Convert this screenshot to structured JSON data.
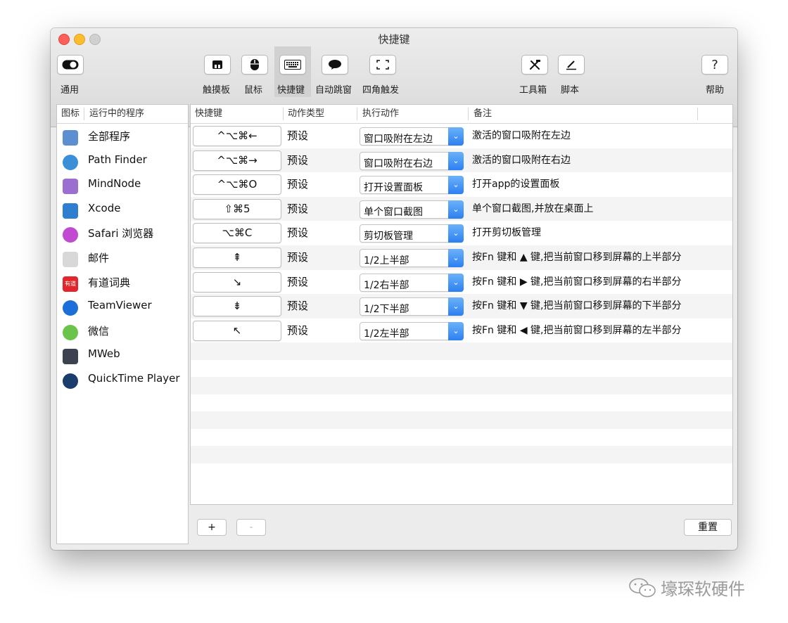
{
  "window": {
    "title": "快捷键"
  },
  "toolbar": {
    "general": "通用",
    "trackpad": "触摸板",
    "mouse": "鼠标",
    "shortcuts": "快捷键",
    "auto_snap": "自动跳窗",
    "hot_corners": "四角触发",
    "toolbox": "工具箱",
    "script": "脚本",
    "help": "帮助",
    "help_glyph": "?"
  },
  "apps_table": {
    "col_icon": "图标",
    "col_program": "运行中的程序",
    "items": [
      {
        "name": "全部程序",
        "icon": "all-programs-icon",
        "color": "#5b8fd0"
      },
      {
        "name": "Path Finder",
        "icon": "path-finder-icon",
        "color": "#3a8fd8"
      },
      {
        "name": "MindNode",
        "icon": "mindnode-icon",
        "color": "#9b6fd0"
      },
      {
        "name": "Xcode",
        "icon": "xcode-icon",
        "color": "#2f7fd0"
      },
      {
        "name": "Safari 浏览器",
        "icon": "safari-icon",
        "color": "#c04ad0"
      },
      {
        "name": "邮件",
        "icon": "mail-icon",
        "color": "#d8d8d8"
      },
      {
        "name": "有道词典",
        "icon": "youdao-icon",
        "color": "#e3262b"
      },
      {
        "name": "TeamViewer",
        "icon": "teamviewer-icon",
        "color": "#1c6fd8"
      },
      {
        "name": "微信",
        "icon": "wechat-icon",
        "color": "#6bc44a"
      },
      {
        "name": "MWeb",
        "icon": "mweb-icon",
        "color": "#3d4250"
      },
      {
        "name": "QuickTime Player",
        "icon": "quicktime-icon",
        "color": "#1a3d6e"
      }
    ],
    "youdao_glyph": "有道"
  },
  "shortcuts_table": {
    "col_key": "快捷键",
    "col_type": "动作类型",
    "col_action": "执行动作",
    "col_note": "备注",
    "rows": [
      {
        "key": "^⌥⌘←",
        "type": "预设",
        "action": "窗口吸附在左边",
        "note": "激活的窗口吸附在左边"
      },
      {
        "key": "^⌥⌘→",
        "type": "预设",
        "action": "窗口吸附在右边",
        "note": "激活的窗口吸附在右边"
      },
      {
        "key": "^⌥⌘O",
        "type": "预设",
        "action": "打开设置面板",
        "note": "打开app的设置面板"
      },
      {
        "key": "⇧⌘5",
        "type": "预设",
        "action": "单个窗口截图",
        "note": "单个窗口截图,并放在桌面上"
      },
      {
        "key": "⌥⌘C",
        "type": "预设",
        "action": "剪切板管理",
        "note": "打开剪切板管理"
      },
      {
        "key": "⇞",
        "type": "预设",
        "action": "1/2上半部",
        "note": "按Fn 键和 ▲ 键,把当前窗口移到屏幕的上半部分"
      },
      {
        "key": "↘",
        "type": "预设",
        "action": "1/2右半部",
        "note": "按Fn 键和 ▶ 键,把当前窗口移到屏幕的右半部分"
      },
      {
        "key": "⇟",
        "type": "预设",
        "action": "1/2下半部",
        "note": "按Fn 键和 ▼ 键,把当前窗口移到屏幕的下半部分"
      },
      {
        "key": "↖",
        "type": "预设",
        "action": "1/2左半部",
        "note": "按Fn 键和 ◀ 键,把当前窗口移到屏幕的左半部分"
      }
    ]
  },
  "footer": {
    "add": "+",
    "remove": "-",
    "reset": "重置"
  },
  "watermark": {
    "text": "壕琛软硬件"
  },
  "colors": {
    "accent": "#2b7ff2",
    "close": "#fc5f57",
    "minimize": "#fdbc2e"
  }
}
